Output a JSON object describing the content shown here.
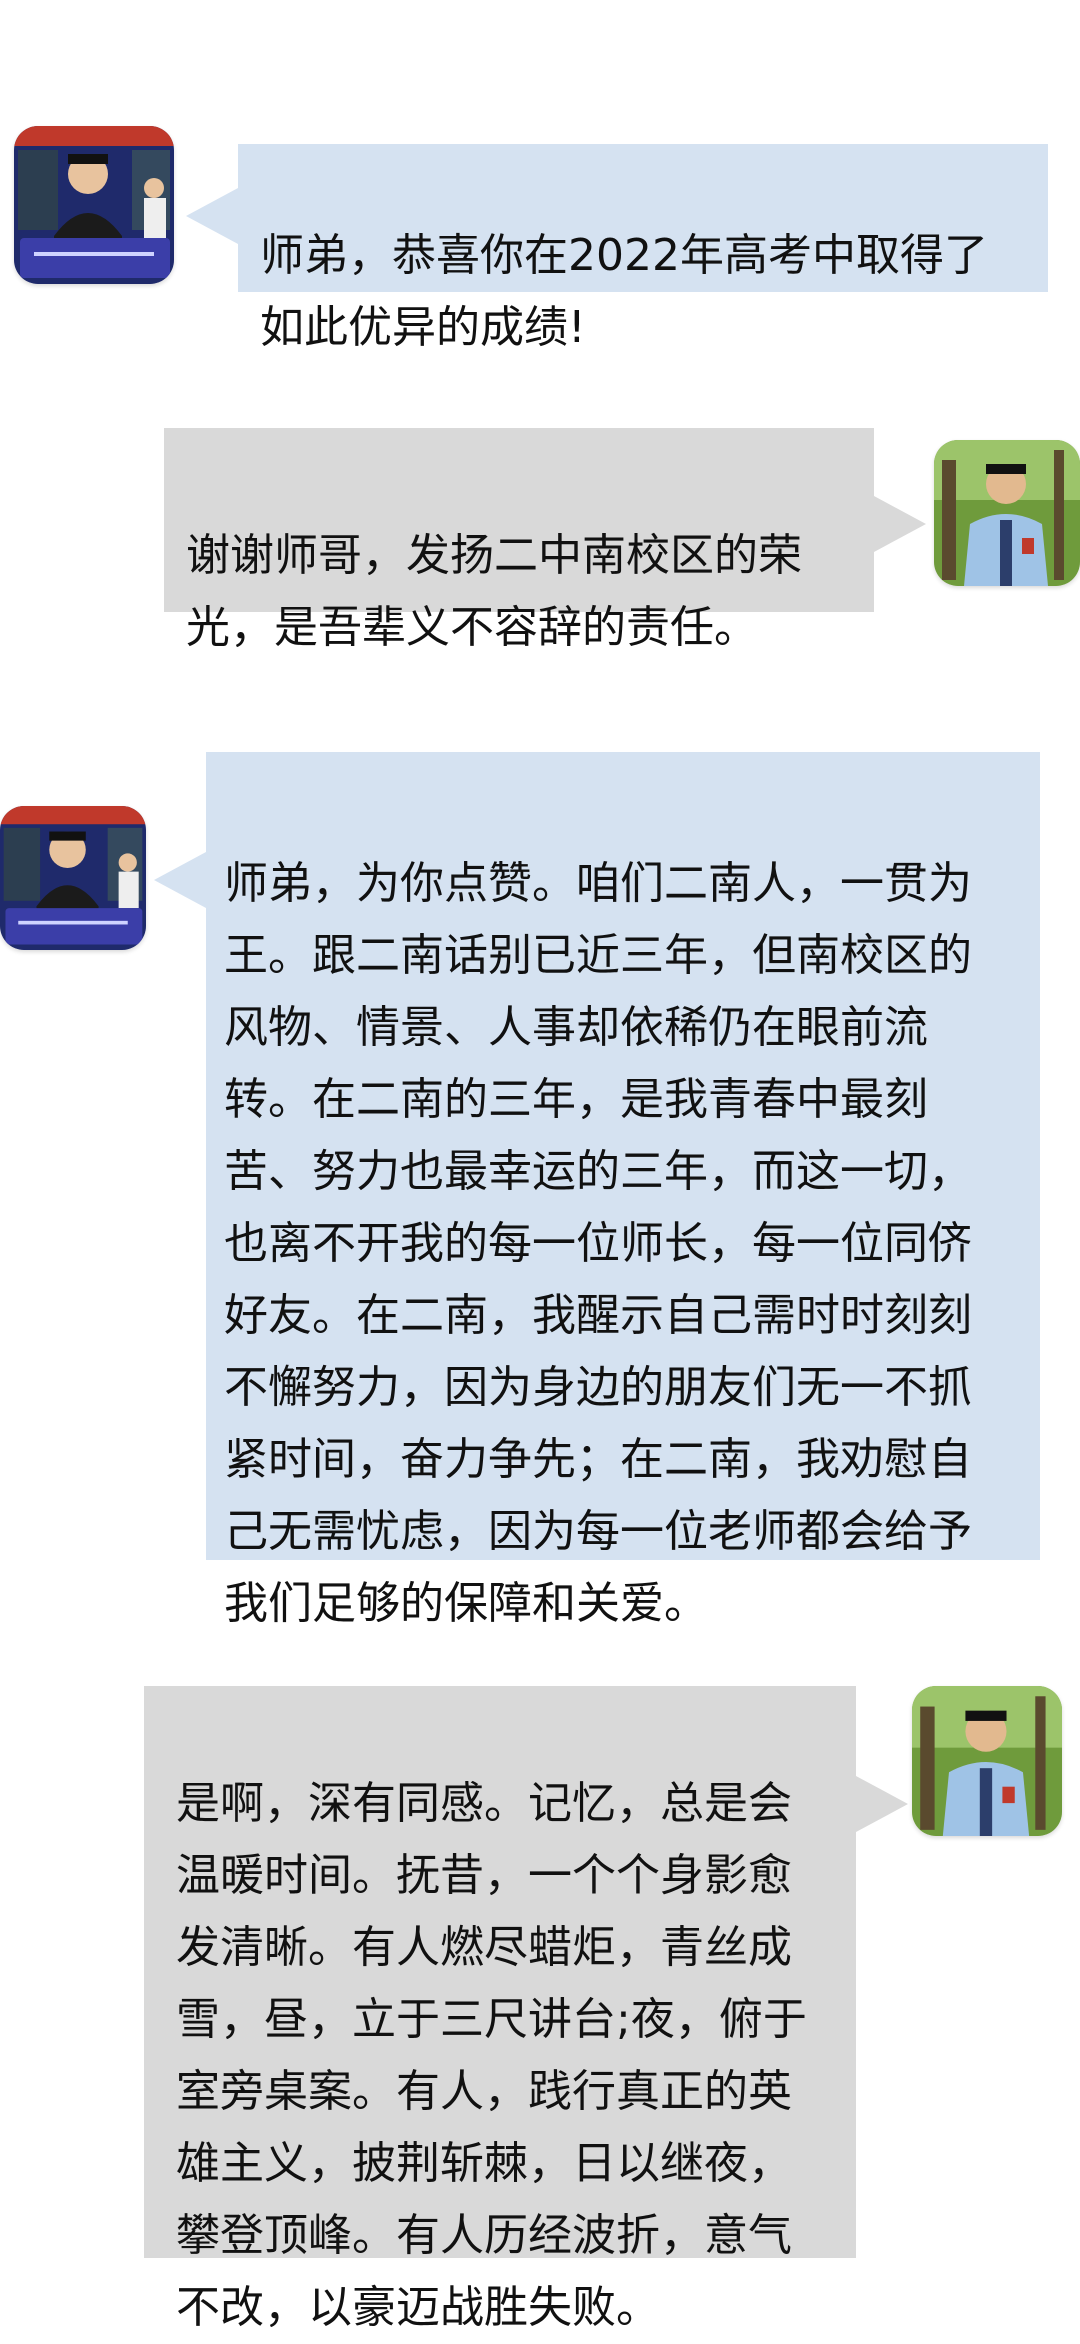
{
  "colors": {
    "incoming_bubble": "#d5e2f1",
    "outgoing_bubble": "#d9d9d9",
    "background": "#ffffff"
  },
  "messages": [
    {
      "side": "left",
      "sender_avatar": "senior-avatar",
      "text": "师弟，恭喜你在2022年高考中取得了\n如此优异的成绩!"
    },
    {
      "side": "right",
      "sender_avatar": "junior-avatar",
      "text": "谢谢师哥，发扬二中南校区的荣\n光，是吾辈义不容辞的责任。"
    },
    {
      "side": "left",
      "sender_avatar": "senior-avatar",
      "text": "师弟，为你点赞。咱们二南人，一贯为\n王。跟二南话别已近三年，但南校区的\n风物、情景、人事却依稀仍在眼前流\n转。在二南的三年，是我青春中最刻\n苦、努力也最幸运的三年，而这一切，\n也离不开我的每一位师长，每一位同侪\n好友。在二南，我醒示自己需时时刻刻\n不懈努力，因为身边的朋友们无一不抓\n紧时间，奋力争先；在二南，我劝慰自\n己无需忧虑，因为每一位老师都会给予\n我们足够的保障和关爱。"
    },
    {
      "side": "right",
      "sender_avatar": "junior-avatar",
      "text": "是啊，深有同感。记忆，总是会\n温暖时间。抚昔，一个个身影愈\n发清晰。有人燃尽蜡炬，青丝成\n雪，昼，立于三尺讲台;夜，俯于\n室旁桌案。有人，践行真正的英\n雄主义，披荆斩棘，日以继夜，\n攀登顶峰。有人历经波折，意气\n不改，以豪迈战胜失败。"
    }
  ]
}
